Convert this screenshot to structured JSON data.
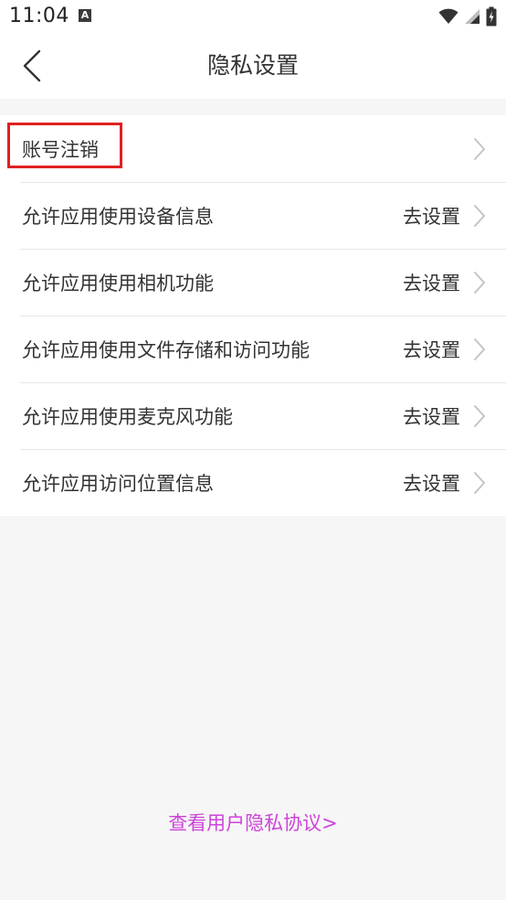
{
  "status_bar": {
    "time": "11:04",
    "notification_icon_letter": "A"
  },
  "header": {
    "title": "隐私设置"
  },
  "settings": [
    {
      "label": "账号注销",
      "action": ""
    },
    {
      "label": "允许应用使用设备信息",
      "action": "去设置"
    },
    {
      "label": "允许应用使用相机功能",
      "action": "去设置"
    },
    {
      "label": "允许应用使用文件存储和访问功能",
      "action": "去设置"
    },
    {
      "label": "允许应用使用麦克风功能",
      "action": "去设置"
    },
    {
      "label": "允许应用访问位置信息",
      "action": "去设置"
    }
  ],
  "footer": {
    "agreement_link": "查看用户隐私协议>"
  },
  "colors": {
    "background": "#f7f6f7",
    "link": "#cc44d9",
    "highlight": "#e02020",
    "text": "#333333"
  }
}
